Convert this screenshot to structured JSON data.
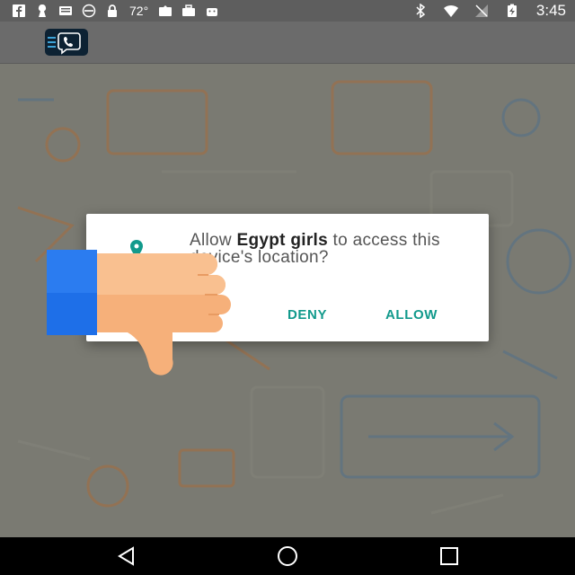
{
  "status_bar": {
    "temperature": "72°",
    "time": "3:45",
    "left_icons": [
      "facebook-icon",
      "keyhole-icon",
      "news-icon",
      "alert-circle-icon",
      "lock-icon",
      "location-app-icon",
      "briefcase-icon",
      "android-icon"
    ],
    "right_icons": [
      "bluetooth-icon",
      "wifi-icon",
      "no-signal-icon",
      "battery-charging-icon"
    ]
  },
  "app_bar": {
    "logo_icon": "phone-chat-logo-icon"
  },
  "dialog": {
    "prefix": "Allow ",
    "app_name": "Egypt girls",
    "suffix": " to access this device's location?",
    "icon": "location-pin-icon",
    "deny_label": "DENY",
    "allow_label": "ALLOW",
    "accent_color": "#129a8c"
  },
  "overlay": {
    "icon": "thumbs-down-icon"
  },
  "nav_bar": {
    "back_icon": "back-triangle-icon",
    "home_icon": "home-circle-icon",
    "recents_icon": "recents-square-icon"
  }
}
